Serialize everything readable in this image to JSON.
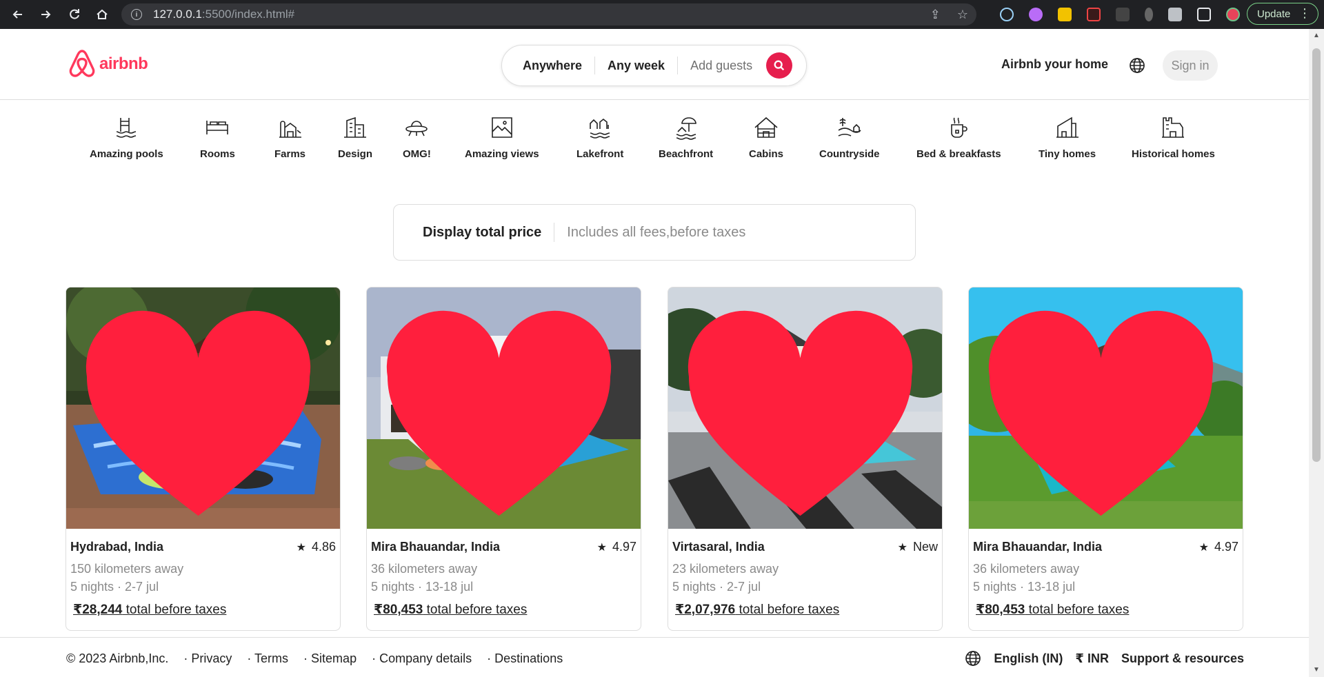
{
  "browser": {
    "url_host": "127.0.0.1",
    "url_rest": ":5500/index.html#",
    "update_label": "Update"
  },
  "header": {
    "logo_text": "airbnb",
    "search": {
      "where": "Anywhere",
      "when": "Any week",
      "guests": "Add guests"
    },
    "host_link": "Airbnb your home",
    "signin": "Sign in"
  },
  "categories": [
    {
      "label": "Amazing pools",
      "icon": "pool-icon"
    },
    {
      "label": "Rooms",
      "icon": "bed-icon"
    },
    {
      "label": "Farms",
      "icon": "farm-icon"
    },
    {
      "label": "Design",
      "icon": "building-icon"
    },
    {
      "label": "OMG!",
      "icon": "ufo-icon"
    },
    {
      "label": "Amazing views",
      "icon": "picture-icon"
    },
    {
      "label": "Lakefront",
      "icon": "lake-icon"
    },
    {
      "label": "Beachfront",
      "icon": "beach-icon"
    },
    {
      "label": "Cabins",
      "icon": "cabin-icon"
    },
    {
      "label": "Countryside",
      "icon": "countryside-icon"
    },
    {
      "label": "Bed & breakfasts",
      "icon": "coffee-icon"
    },
    {
      "label": "Tiny homes",
      "icon": "tiny-home-icon"
    },
    {
      "label": "Historical homes",
      "icon": "castle-icon"
    }
  ],
  "price_toggle": {
    "title": "Display total price",
    "subtitle": "Includes all fees,before taxes"
  },
  "listings": [
    {
      "location": "Hydrabad, India",
      "rating": "4.86",
      "distance": "150 kilometers away",
      "dates": "5 nights · 2-7 jul",
      "price": "₹28,244",
      "price_suffix": " total before taxes"
    },
    {
      "location": "Mira Bhauandar, India",
      "rating": "4.97",
      "distance": "36 kilometers away",
      "dates": "5 nights · 13-18 jul",
      "price": "₹80,453",
      "price_suffix": " total before taxes"
    },
    {
      "location": "Virtasaral, India",
      "rating": "New",
      "distance": "23 kilometers away",
      "dates": "5 nights · 2-7 jul",
      "price": "₹2,07,976",
      "price_suffix": " total before taxes"
    },
    {
      "location": "Mira Bhauandar, India",
      "rating": "4.97",
      "distance": "36 kilometers away",
      "dates": "5 nights · 13-18 jul",
      "price": "₹80,453",
      "price_suffix": " total before taxes"
    }
  ],
  "footer": {
    "copyright": "© 2023 Airbnb,Inc.",
    "links": [
      "· Privacy",
      "· Terms",
      "· Sitemap",
      "· Company details",
      "· Destinations"
    ],
    "language": "English (IN)",
    "currency": "₹ INR",
    "support": "Support & resources"
  },
  "colors": {
    "brand": "#ff385c",
    "search_button": "#e61e4d",
    "heart": "#ff1f3d"
  }
}
